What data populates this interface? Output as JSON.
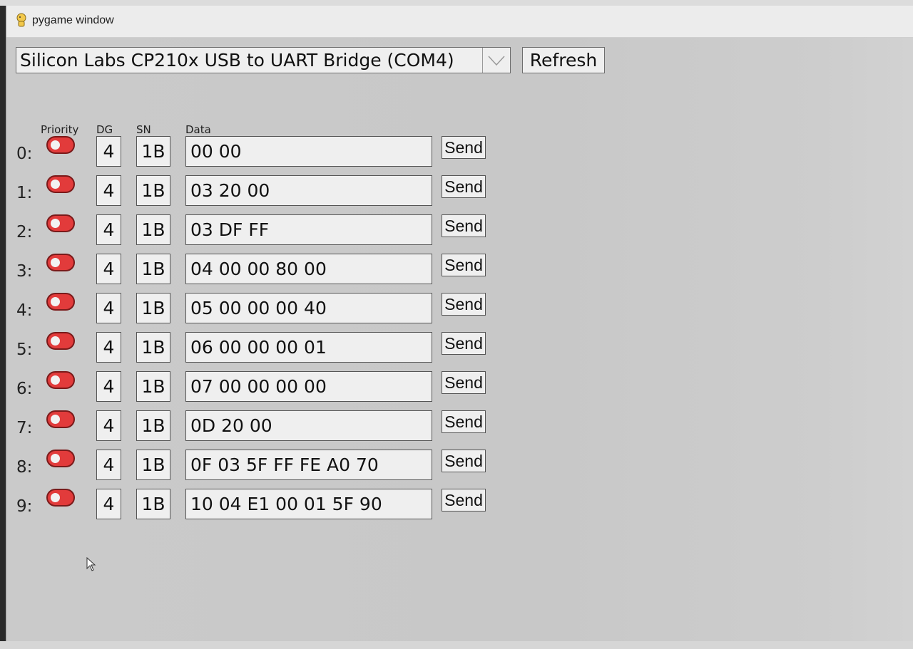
{
  "window": {
    "title": "pygame window"
  },
  "port_select": {
    "value": "Silicon Labs CP210x USB to UART Bridge (COM4)"
  },
  "refresh_button": {
    "label": "Refresh"
  },
  "headers": {
    "priority": "Priority",
    "dg": "DG",
    "sn": "SN",
    "data": "Data"
  },
  "rows": [
    {
      "index": "0:",
      "dg": "4",
      "sn": "1B",
      "data": "00 00",
      "send": "Send"
    },
    {
      "index": "1:",
      "dg": "4",
      "sn": "1B",
      "data": "03 20 00",
      "send": "Send"
    },
    {
      "index": "2:",
      "dg": "4",
      "sn": "1B",
      "data": "03 DF FF",
      "send": "Send"
    },
    {
      "index": "3:",
      "dg": "4",
      "sn": "1B",
      "data": "04 00 00 80 00",
      "send": "Send"
    },
    {
      "index": "4:",
      "dg": "4",
      "sn": "1B",
      "data": "05 00 00 00 40",
      "send": "Send"
    },
    {
      "index": "5:",
      "dg": "4",
      "sn": "1B",
      "data": "06 00 00 00 01",
      "send": "Send"
    },
    {
      "index": "6:",
      "dg": "4",
      "sn": "1B",
      "data": "07 00 00 00 00",
      "send": "Send"
    },
    {
      "index": "7:",
      "dg": "4",
      "sn": "1B",
      "data": "0D 20 00",
      "send": "Send"
    },
    {
      "index": "8:",
      "dg": "4",
      "sn": "1B",
      "data": "0F 03 5F FF FE A0 70",
      "send": "Send"
    },
    {
      "index": "9:",
      "dg": "4",
      "sn": "1B",
      "data": "10 04 E1 00 01 5F 90",
      "send": "Send"
    }
  ],
  "colors": {
    "toggle_off": "#e23b3b",
    "background": "#c9c9c9",
    "field_bg": "#efefef"
  }
}
